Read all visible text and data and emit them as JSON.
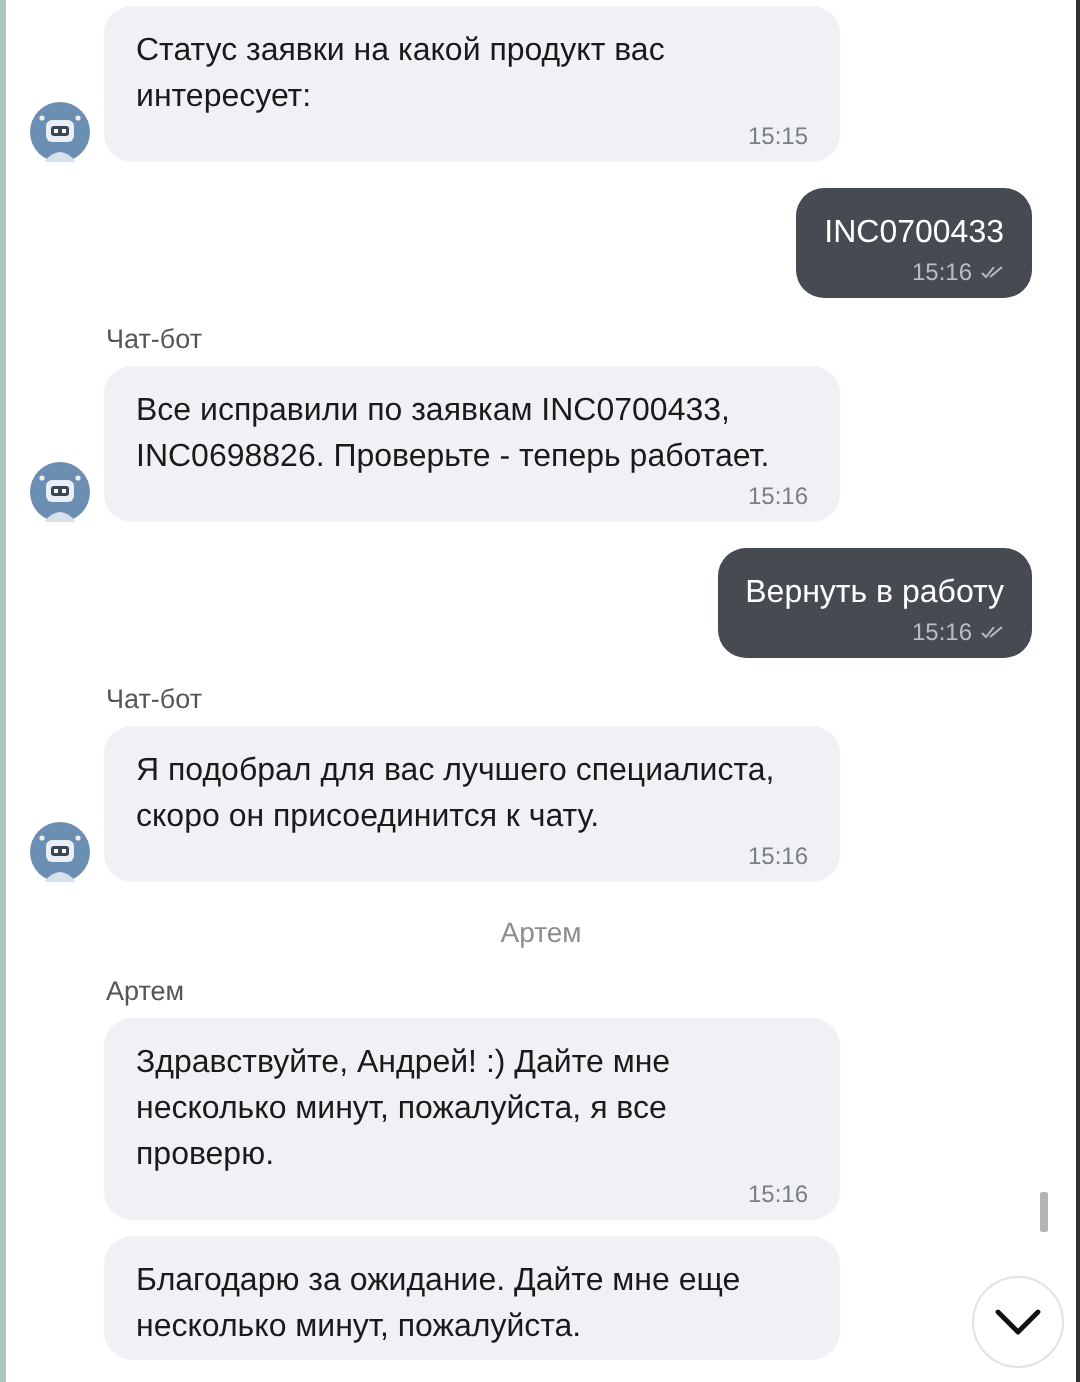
{
  "messages": [
    {
      "kind": "incoming",
      "avatar": true,
      "text": "Статус заявки на какой продукт вас интересует:",
      "time": "15:15"
    },
    {
      "kind": "outgoing",
      "text": "INC0700433",
      "time": "15:16",
      "read": true
    },
    {
      "kind": "incoming",
      "sender": "Чат-бот",
      "avatar": true,
      "text": "Все исправили по заявкам INC0700433, INC0698826. Проверьте - теперь работает.",
      "time": "15:16"
    },
    {
      "kind": "outgoing",
      "text": "Вернуть в работу",
      "time": "15:16",
      "read": true
    },
    {
      "kind": "incoming",
      "sender": "Чат-бот",
      "avatar": true,
      "text": "Я подобрал для вас лучшего специалиста, скоро он присоединится к чату.",
      "time": "15:16"
    },
    {
      "kind": "system",
      "text": "Артем"
    },
    {
      "kind": "incoming",
      "sender": "Артем",
      "avatar": false,
      "text": "Здравствуйте, Андрей! :) Дайте мне несколько минут, пожалуйста, я все проверю.",
      "time": "15:16"
    },
    {
      "kind": "incoming",
      "avatar": false,
      "text": "Благодарю за ожидание. Дайте мне еще несколько минут, пожалуйста."
    }
  ]
}
